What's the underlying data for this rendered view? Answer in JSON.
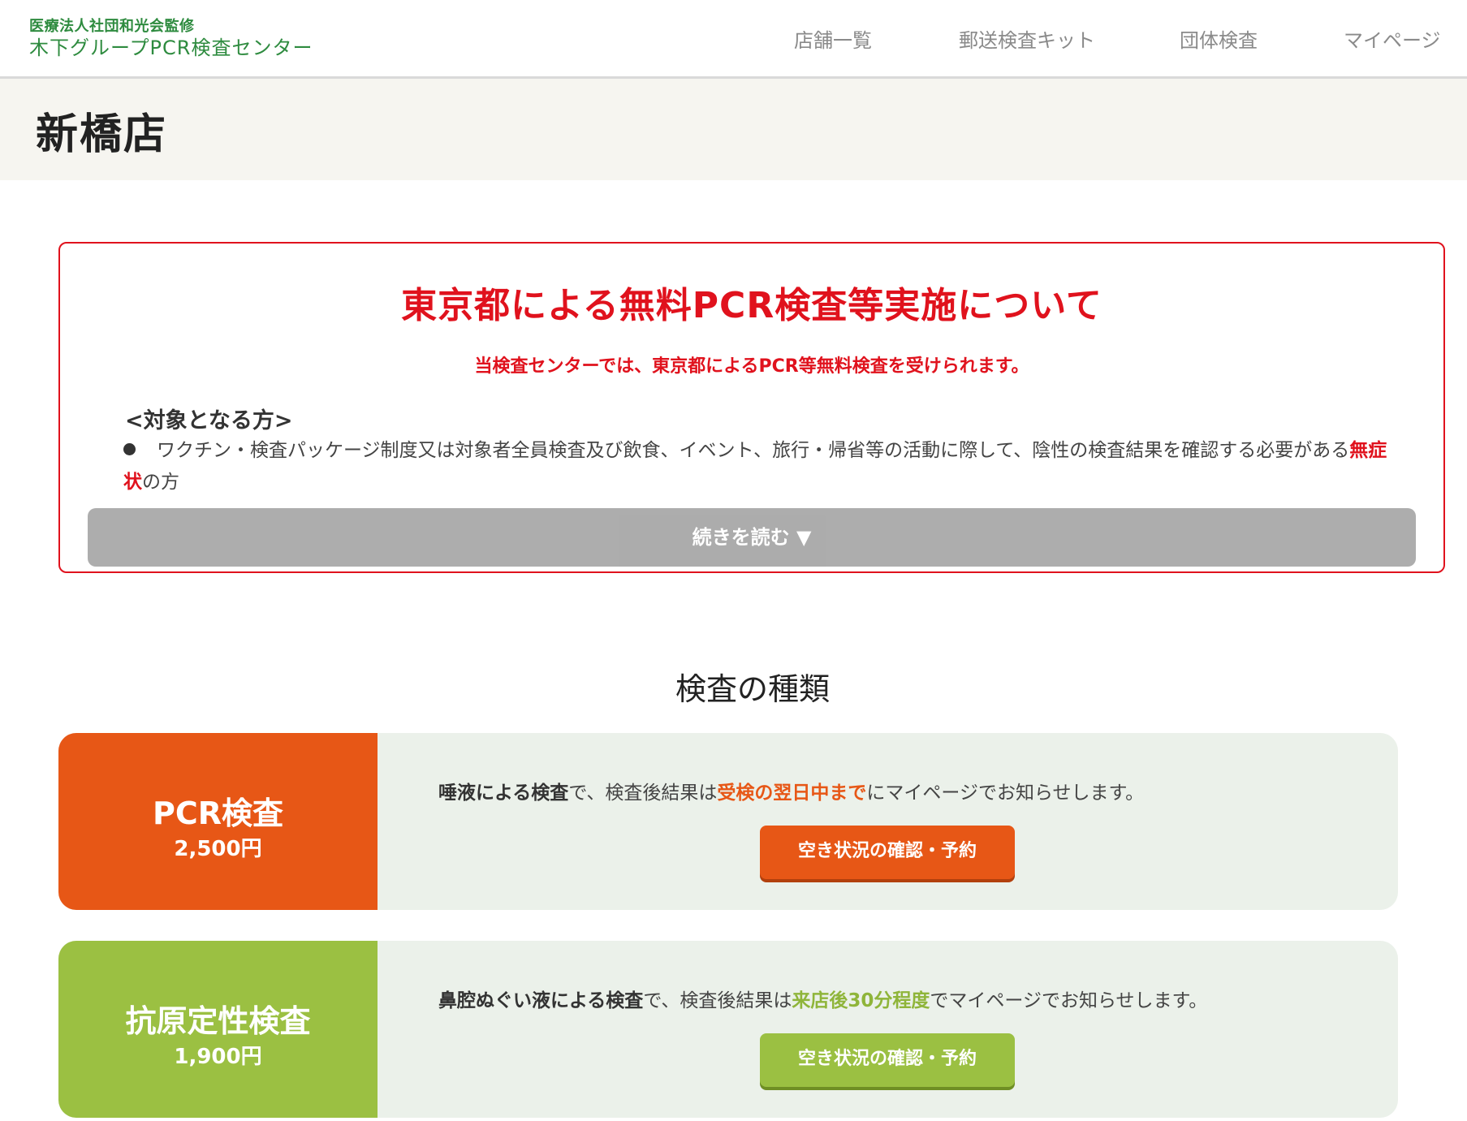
{
  "header": {
    "org": "医療法人社団和光会監修",
    "brand": "木下グループPCR検査センター",
    "nav": [
      "店舗一覧",
      "郵送検査キット",
      "団体検査",
      "マイページ"
    ]
  },
  "page_title": "新橋店",
  "notice": {
    "title": "東京都による無料PCR検査等実施について",
    "subtitle": "当検査センターでは、東京都によるPCR等無料検査を受けられます。",
    "target_heading": "<対象となる方>",
    "item1_text_a": "ワクチン・検査パッケージ制度又は対象者全員検査及び飲食、イベント、旅行・帰省等の活動に際して、陰性の検査結果を確認する必要がある",
    "item1_text_red": "無症状",
    "item1_text_b": "の方",
    "read_more": "続きを読む ▼"
  },
  "section_title": "検査の種類",
  "tests": [
    {
      "name": "PCR検査",
      "price": "2,500円",
      "color": "#e75716",
      "desc_bold": "唾液による検査",
      "desc_mid": "で、検査後結果は",
      "desc_highlight": "受検の翌日中まで",
      "desc_end": "にマイページでお知らせします。",
      "button": "空き状況の確認・予約"
    },
    {
      "name": "抗原定性検査",
      "price": "1,900円",
      "color": "#9bc042",
      "desc_bold": "鼻腔ぬぐい液による検査",
      "desc_mid": "で、検査後結果は",
      "desc_highlight": "来店後30分程度",
      "desc_end": "でマイページでお知らせします。",
      "button": "空き状況の確認・予約"
    }
  ],
  "colors": {
    "brand_green": "#2e8b3f",
    "alert_red": "#e0121d",
    "pcr_orange": "#e75716",
    "antigen_green": "#9bc042"
  }
}
